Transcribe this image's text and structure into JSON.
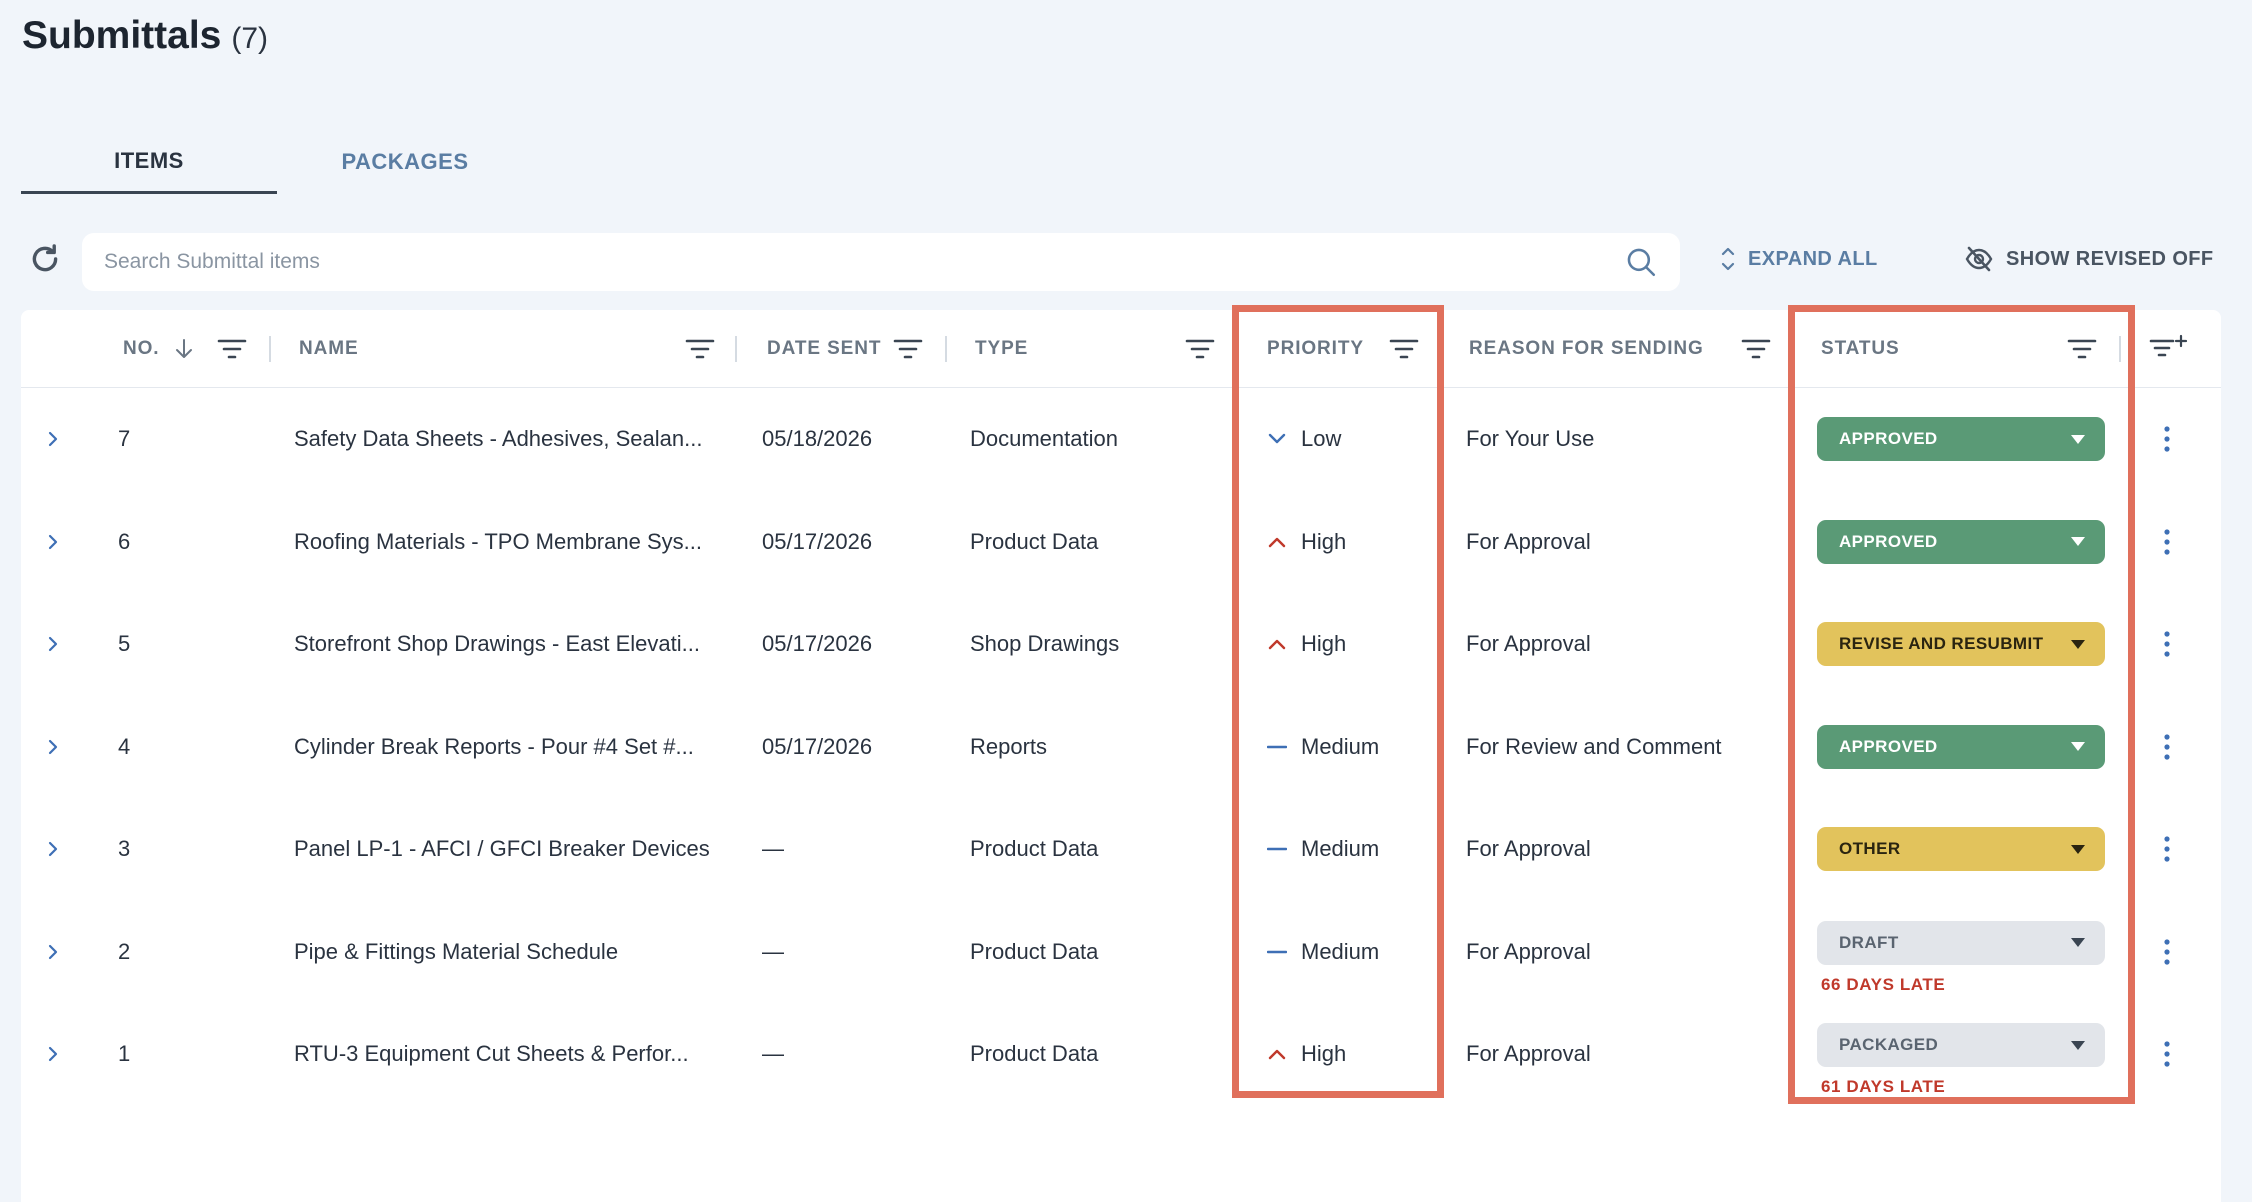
{
  "page": {
    "title": "Submittals",
    "count": "(7)"
  },
  "tabs": [
    {
      "label": "ITEMS",
      "active": true
    },
    {
      "label": "PACKAGES",
      "active": false
    }
  ],
  "search": {
    "placeholder": "Search Submittal items",
    "value": ""
  },
  "toolbar": {
    "expand_all": "EXPAND ALL",
    "show_revised": "SHOW REVISED OFF"
  },
  "columns": {
    "no": "NO.",
    "name": "NAME",
    "date_sent": "DATE SENT",
    "type": "TYPE",
    "priority": "PRIORITY",
    "reason": "REASON FOR SENDING",
    "status": "STATUS"
  },
  "icons": {
    "refresh": "refresh-icon",
    "search": "search-icon",
    "expand": "expand-collapse-icon",
    "revised": "eye-off-icon",
    "filter": "filter-icon",
    "sort": "arrow-down-icon",
    "add_filter": "filter-add-icon",
    "row_expand": "chevron-right-icon",
    "row_menu": "kebab-icon"
  },
  "colors": {
    "approved": "#5a9a76",
    "revise": "#e2c35c",
    "other": "#e2c35c",
    "draft": "#e2e5ea",
    "packaged": "#e2e5ea",
    "late": "#c0392b",
    "priority_low": "#3e6fb5",
    "priority_high": "#c0392b",
    "priority_medium": "#3e6fb5",
    "highlight": "#e0705c"
  },
  "rows": [
    {
      "no": "7",
      "name": "Safety Data Sheets - Adhesives, Sealan...",
      "date_sent": "05/18/2026",
      "type": "Documentation",
      "priority": "Low",
      "priority_level": "low",
      "reason": "For Your Use",
      "status": "APPROVED",
      "status_kind": "approved",
      "late": ""
    },
    {
      "no": "6",
      "name": "Roofing Materials - TPO Membrane Sys...",
      "date_sent": "05/17/2026",
      "type": "Product Data",
      "priority": "High",
      "priority_level": "high",
      "reason": "For Approval",
      "status": "APPROVED",
      "status_kind": "approved",
      "late": ""
    },
    {
      "no": "5",
      "name": "Storefront Shop Drawings - East Elevati...",
      "date_sent": "05/17/2026",
      "type": "Shop Drawings",
      "priority": "High",
      "priority_level": "high",
      "reason": "For Approval",
      "status": "REVISE AND RESUBMIT",
      "status_kind": "revise",
      "late": ""
    },
    {
      "no": "4",
      "name": "Cylinder Break Reports - Pour #4 Set #...",
      "date_sent": "05/17/2026",
      "type": "Reports",
      "priority": "Medium",
      "priority_level": "medium",
      "reason": "For Review and Comment",
      "status": "APPROVED",
      "status_kind": "approved",
      "late": ""
    },
    {
      "no": "3",
      "name": "Panel LP-1 - AFCI / GFCI Breaker Devices",
      "date_sent": "—",
      "type": "Product Data",
      "priority": "Medium",
      "priority_level": "medium",
      "reason": "For Approval",
      "status": "OTHER",
      "status_kind": "other",
      "late": ""
    },
    {
      "no": "2",
      "name": "Pipe & Fittings Material Schedule",
      "date_sent": "—",
      "type": "Product Data",
      "priority": "Medium",
      "priority_level": "medium",
      "reason": "For Approval",
      "status": "DRAFT",
      "status_kind": "draft",
      "late": "66 DAYS LATE"
    },
    {
      "no": "1",
      "name": "RTU-3 Equipment Cut Sheets & Perfor...",
      "date_sent": "—",
      "type": "Product Data",
      "priority": "High",
      "priority_level": "high",
      "reason": "For Approval",
      "status": "PACKAGED",
      "status_kind": "packaged",
      "late": "61 DAYS LATE"
    }
  ]
}
